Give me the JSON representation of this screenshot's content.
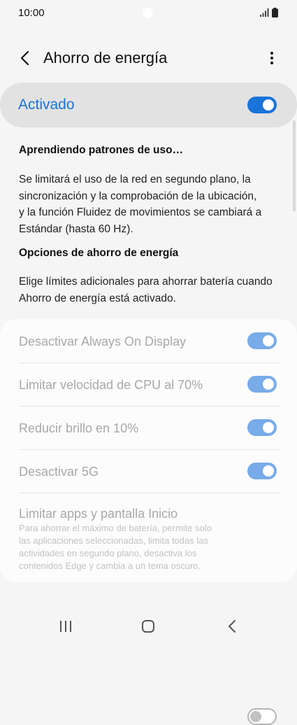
{
  "status_bar": {
    "time": "10:00",
    "icons": [
      "signal-icon",
      "battery-icon"
    ]
  },
  "header": {
    "title": "Ahorro de energía",
    "icons": [
      "back-arrow-icon",
      "more-options-icon"
    ]
  },
  "master_toggle": {
    "label": "Activado",
    "state": "on"
  },
  "info": {
    "learning_title": "Aprendiendo patrones de uso…",
    "learning_lines": [
      "Se limitará el uso de la red en segundo plano, la",
      "sincronización y la comprobación de la ubicación,",
      "y la función Fluidez de movimientos se cambiará a",
      "Estándar (hasta 60 Hz)."
    ],
    "options_title": "Opciones de ahorro de energía",
    "options_lines": [
      "Elige límites adicionales para ahorrar batería cuando",
      "Ahorro de energía está activado."
    ]
  },
  "options": [
    {
      "label": "Desactivar Always On Display",
      "state": "on"
    },
    {
      "label": "Limitar velocidad de CPU al 70%",
      "state": "on"
    },
    {
      "label": "Reducir brillo en 10%",
      "state": "on"
    },
    {
      "label": "Desactivar 5G",
      "state": "on"
    },
    {
      "label": "Limitar apps y pantalla Inicio",
      "state": "off",
      "description_lines": [
        "Para ahorrar el máximo de batería, permite solo",
        "las aplicaciones seleccionadas, limita todas las",
        "actividades en segundo plano, desactiva los",
        "contenidos Edge y cambia a un tema oscuro."
      ]
    }
  ],
  "nav_bar": {
    "icons": [
      "recent-apps-icon",
      "home-icon",
      "back-icon"
    ]
  },
  "colors": {
    "accent": "#1a73d9",
    "accent_dim": "#78abe8",
    "disabled_text": "#a8a8a8",
    "background": "#f5f5f5"
  }
}
